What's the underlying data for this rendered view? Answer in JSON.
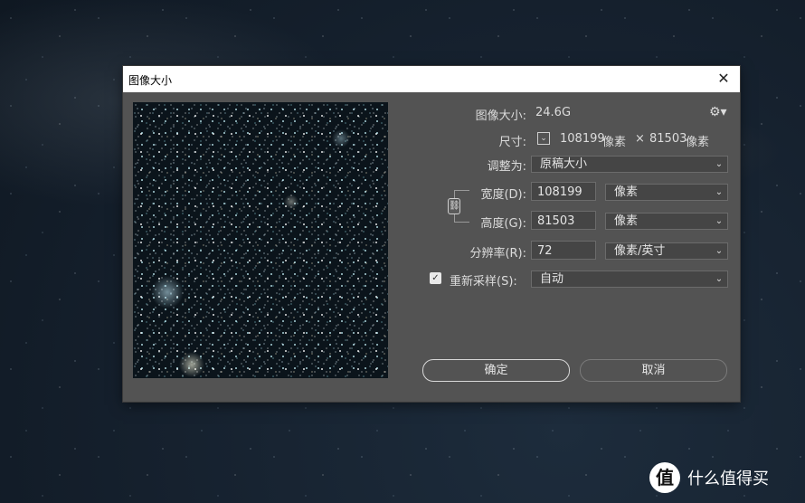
{
  "dialog": {
    "title": "图像大小",
    "close_glyph": "✕",
    "image_size_label": "图像大小:",
    "image_size_value": "24.6G",
    "dimensions_label": "尺寸:",
    "dimensions_width": "108199",
    "dimensions_unit1": "像素",
    "dimensions_times": "×",
    "dimensions_height": "81503",
    "dimensions_unit2": "像素",
    "fit_to_label": "调整为:",
    "fit_to_value": "原稿大小",
    "width_label": "宽度(D):",
    "width_value": "108199",
    "width_unit": "像素",
    "height_label": "高度(G):",
    "height_value": "81503",
    "height_unit": "像素",
    "resolution_label": "分辨率(R):",
    "resolution_value": "72",
    "resolution_unit": "像素/英寸",
    "resample_label": "重新采样(S):",
    "resample_checked": true,
    "resample_value": "自动",
    "ok_label": "确定",
    "cancel_label": "取消"
  },
  "icons": {
    "gear": "gear-icon",
    "chevron": "chevron-down-icon",
    "link": "chain-link-icon",
    "check": "checkmark-icon"
  },
  "watermark": {
    "logo_glyph": "值",
    "text": "什么值得买"
  }
}
